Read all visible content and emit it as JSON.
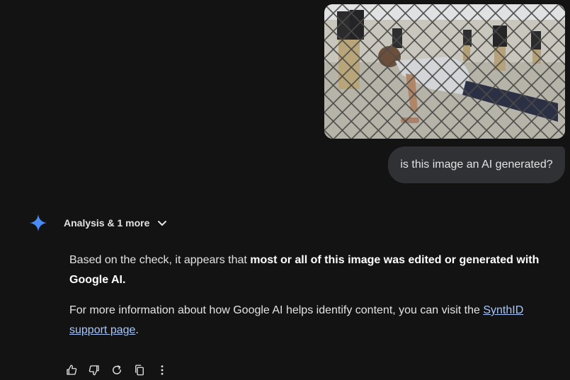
{
  "user_message": {
    "image_alt": "Man doing push-ups behind chain-link fence with guards",
    "text": "is this image an AI generated?"
  },
  "response": {
    "tools_label": "Analysis & 1 more",
    "paragraph1_prefix": "Based on the check, it appears that ",
    "paragraph1_bold": "most or all of this image was edited or generated with Google AI.",
    "paragraph2_prefix": "For more information about how Google AI helps identify content, you can visit the ",
    "paragraph2_link": "SynthID support page",
    "paragraph2_suffix": "."
  },
  "actions": {
    "icons": [
      "thumbs-up-icon",
      "thumbs-down-icon",
      "regenerate-icon",
      "copy-icon",
      "more-options-icon"
    ]
  },
  "colors": {
    "background": "#131314",
    "bubble": "#303134",
    "link": "#a8c7fa",
    "spark": "#4a8cf7"
  }
}
